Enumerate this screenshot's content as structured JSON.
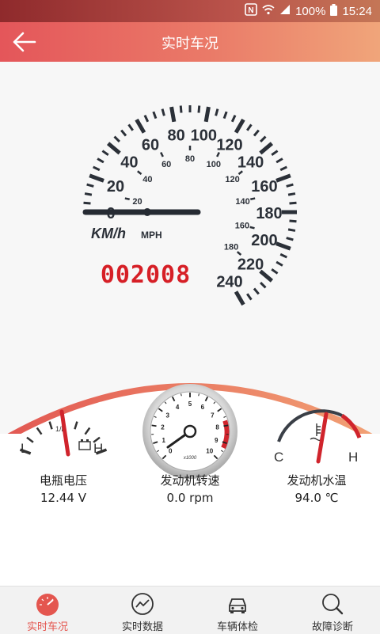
{
  "status_bar": {
    "battery": "100%",
    "time": "15:24",
    "nfc_icon": "nfc-icon",
    "wifi_icon": "wifi-icon",
    "signal_icon": "signal-icon",
    "battery_icon": "battery-icon"
  },
  "header": {
    "title": "实时车况",
    "back_icon": "back-arrow-icon"
  },
  "speedometer": {
    "kmh_ticks": [
      "0",
      "20",
      "40",
      "60",
      "80",
      "100",
      "120",
      "140",
      "160",
      "180",
      "200",
      "220",
      "240"
    ],
    "mph_ticks": [
      "20",
      "40",
      "60",
      "80",
      "100",
      "120",
      "140",
      "160",
      "180"
    ],
    "kmh_unit": "KM/h",
    "mph_unit": "MPH",
    "odometer": "002008",
    "speed": 0
  },
  "gauges": {
    "battery": {
      "label": "电瓶电压",
      "value": "12.44 V",
      "low": "L",
      "high": "H",
      "half": "1/2"
    },
    "rpm": {
      "label": "发动机转速",
      "value": "0.0 rpm",
      "ticks": [
        "0",
        "1",
        "2",
        "3",
        "4",
        "5",
        "6",
        "7",
        "8",
        "9",
        "10"
      ],
      "multiplier": "x1000"
    },
    "temp": {
      "label": "发动机水温",
      "value": "94.0 ℃",
      "low": "C",
      "high": "H"
    }
  },
  "bottom_nav": [
    {
      "label": "实时车况",
      "icon": "speedometer-icon",
      "active": true
    },
    {
      "label": "实时数据",
      "icon": "chart-line-icon",
      "active": false
    },
    {
      "label": "车辆体检",
      "icon": "car-icon",
      "active": false
    },
    {
      "label": "故障诊断",
      "icon": "magnifier-icon",
      "active": false
    }
  ],
  "colors": {
    "accent": "#e4564f",
    "header_start": "#e4565a",
    "header_end": "#f0a57a",
    "needle": "#d0242c"
  }
}
